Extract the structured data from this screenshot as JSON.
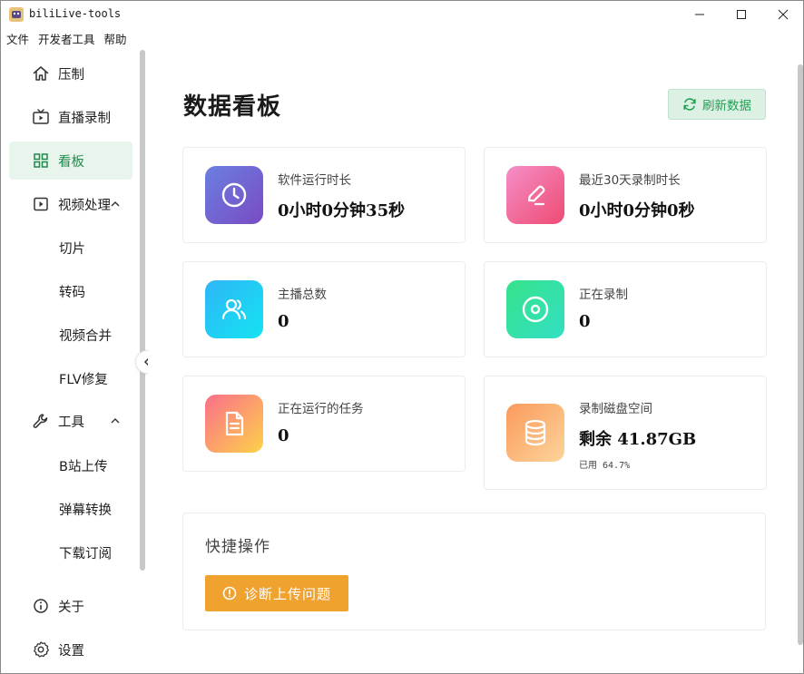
{
  "window": {
    "title": "biliLive-tools"
  },
  "menu": [
    "文件",
    "开发者工具",
    "帮助"
  ],
  "sidebar": {
    "items": [
      {
        "label": "压制",
        "icon": "home-icon"
      },
      {
        "label": "直播录制",
        "icon": "tv-icon"
      },
      {
        "label": "看板",
        "icon": "dashboard-icon",
        "active": true
      },
      {
        "label": "视频处理",
        "icon": "video-icon",
        "expanded": true
      },
      {
        "label": "切片"
      },
      {
        "label": "转码"
      },
      {
        "label": "视频合并"
      },
      {
        "label": "FLV修复"
      },
      {
        "label": "工具",
        "icon": "wrench-icon",
        "expanded": true
      },
      {
        "label": "B站上传"
      },
      {
        "label": "弹幕转换"
      },
      {
        "label": "下载订阅"
      },
      {
        "label": "关于",
        "icon": "info-icon"
      },
      {
        "label": "设置",
        "icon": "gear-icon"
      }
    ]
  },
  "main": {
    "title": "数据看板",
    "refresh_label": "刷新数据",
    "cards": [
      {
        "label": "软件运行时长",
        "value": "0小时0分钟35秒",
        "icon": "clock-icon",
        "colors": [
          "#6a7fe0",
          "#7a4bc4"
        ]
      },
      {
        "label": "最近30天录制时长",
        "value": "0小时0分钟0秒",
        "icon": "pen-icon",
        "colors": [
          "#f58ec8",
          "#ee4b72"
        ]
      },
      {
        "label": "主播总数",
        "value": "0",
        "icon": "users-icon",
        "colors": [
          "#2eb6f6",
          "#15e3f2"
        ]
      },
      {
        "label": "正在录制",
        "value": "0",
        "icon": "record-icon",
        "colors": [
          "#36e28a",
          "#33e0c4"
        ]
      },
      {
        "label": "正在运行的任务",
        "value": "0",
        "icon": "file-icon",
        "colors": [
          "#fa6f8a",
          "#fdd14a"
        ]
      },
      {
        "label": "录制磁盘空间",
        "value": "剩余 41.87GB",
        "sub": "已用 64.7%",
        "icon": "database-icon",
        "colors": [
          "#fb9a5c",
          "#fcd49a"
        ]
      }
    ],
    "quick": {
      "title": "快捷操作",
      "button_label": "诊断上传问题"
    }
  },
  "colors": {
    "accent_green": "#20a152",
    "active_bg": "#e7f5ec",
    "warning_button": "#f0a22f"
  }
}
